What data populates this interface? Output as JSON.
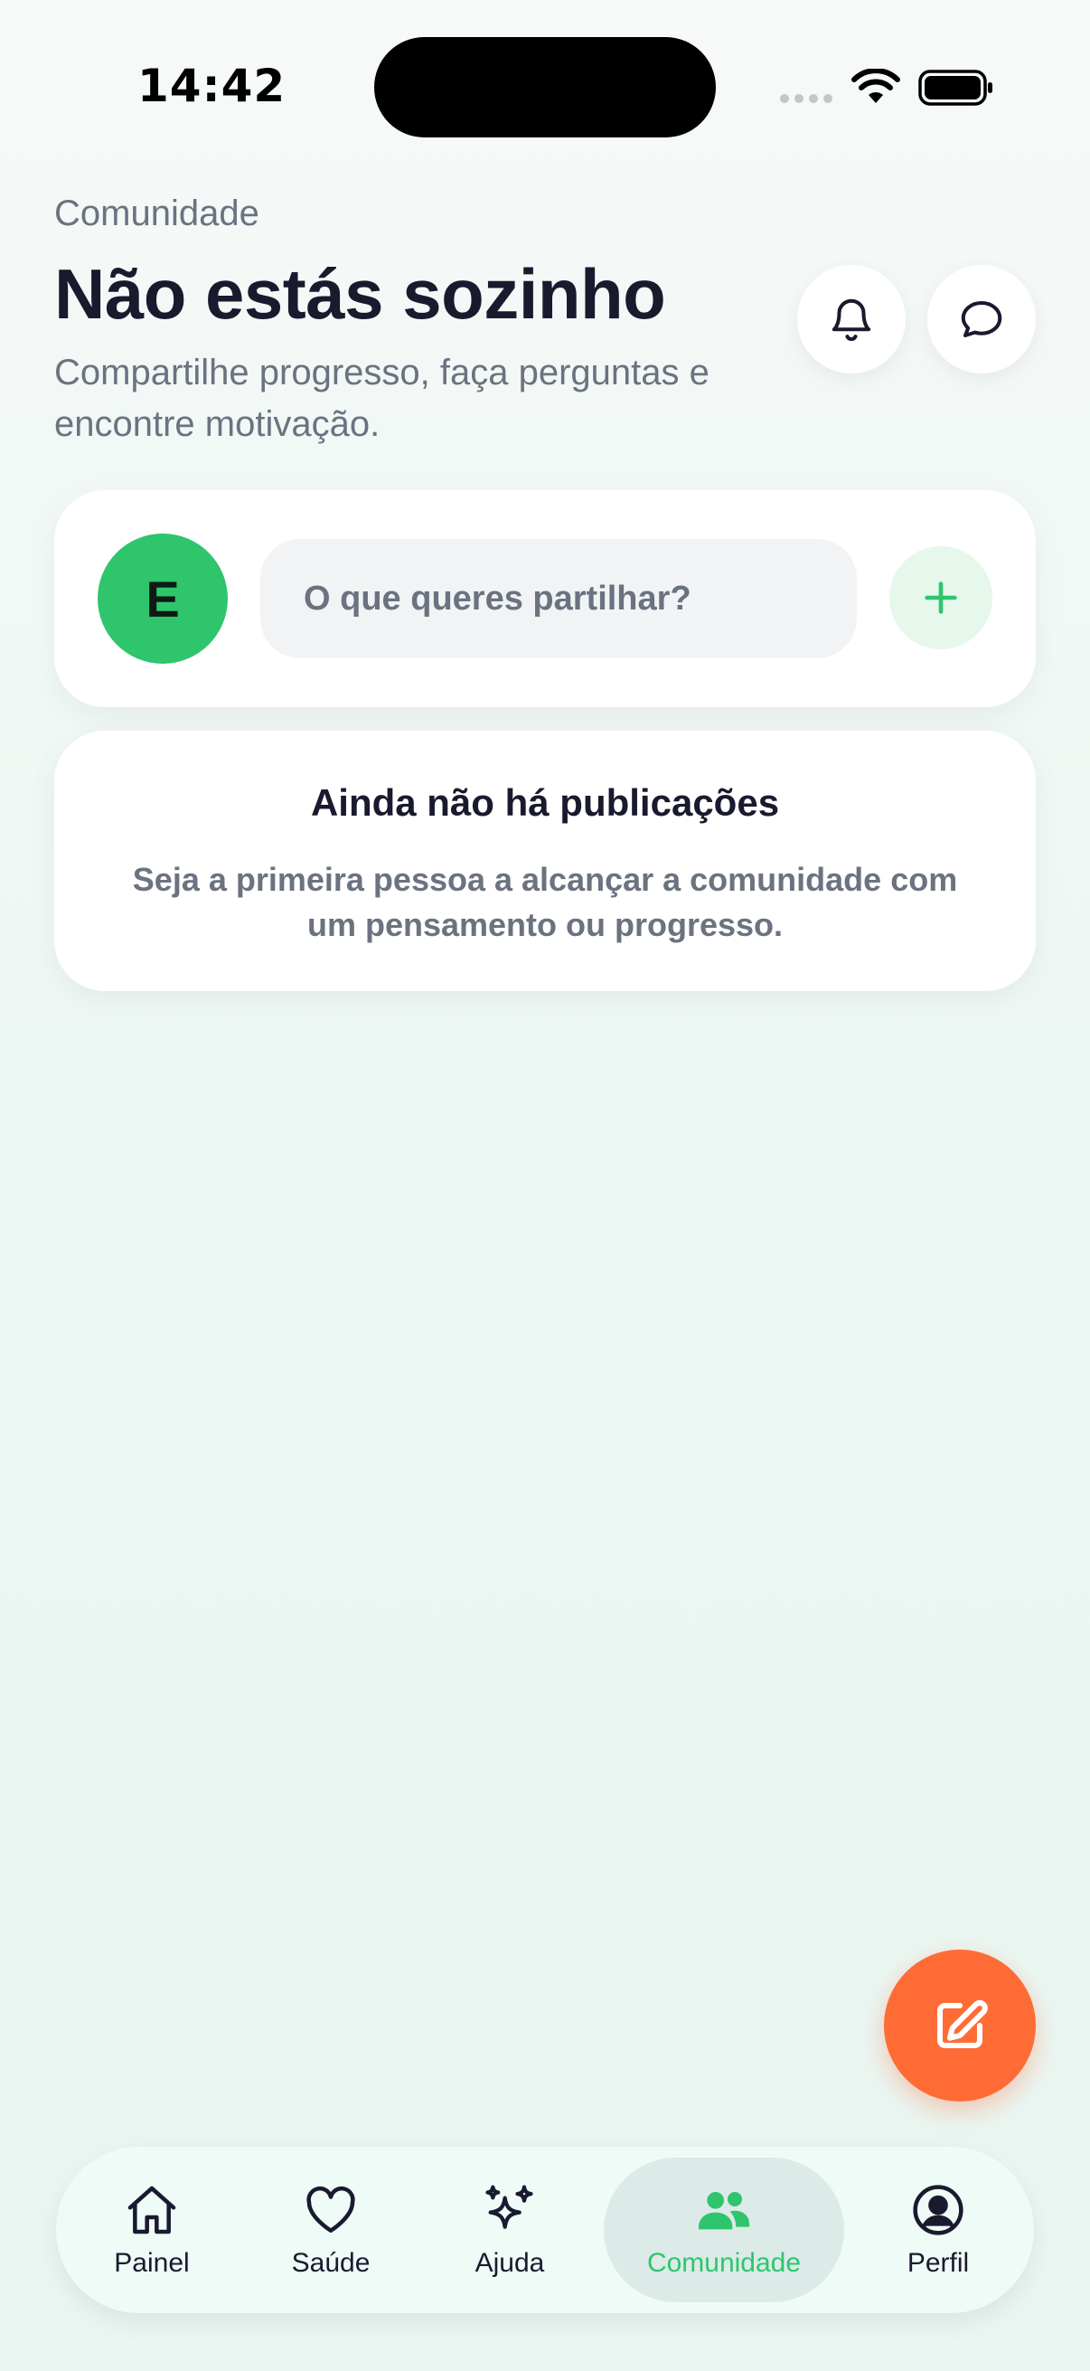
{
  "status_bar": {
    "time": "14:42"
  },
  "header": {
    "section": "Comunidade",
    "title": "Não estás sozinho",
    "subtitle": "Compartilhe progresso, faça perguntas e encontre motivação."
  },
  "composer": {
    "avatar_initial": "E",
    "placeholder": "O que queres partilhar?"
  },
  "empty_state": {
    "title": "Ainda não há publicações",
    "text": "Seja a primeira pessoa a alcançar a comunidade com um pensamento ou progresso."
  },
  "nav": {
    "items": [
      {
        "label": "Painel",
        "icon": "home-icon"
      },
      {
        "label": "Saúde",
        "icon": "heart-icon"
      },
      {
        "label": "Ajuda",
        "icon": "sparkles-icon"
      },
      {
        "label": "Comunidade",
        "icon": "users-icon",
        "active": true
      },
      {
        "label": "Perfil",
        "icon": "user-circle-icon"
      }
    ]
  },
  "colors": {
    "brand_green": "#2ec56d",
    "fab_orange": "#ff6b35",
    "text_dark": "#1a1a2e",
    "text_muted": "#6b7280"
  }
}
